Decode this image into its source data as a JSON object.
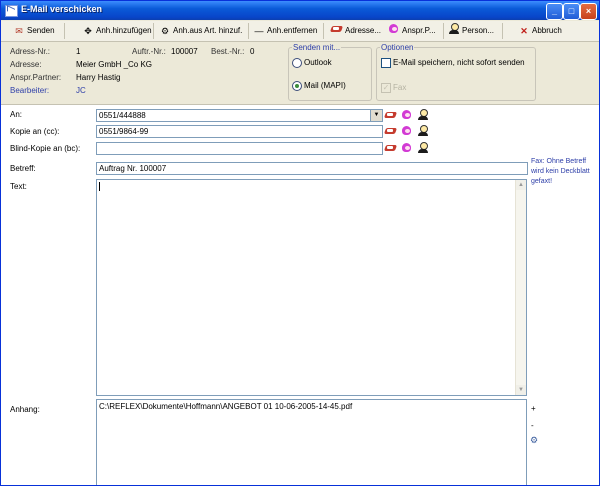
{
  "window": {
    "title": "E-Mail verschicken"
  },
  "toolbar": {
    "send": "Senden",
    "add_attachment": "Anh.hinzufügen",
    "add_from_article": "Anh.aus Art. hinzuf.",
    "remove_attachment": "Anh.entfernen",
    "address": "Adresse...",
    "contact_person": "Anspr.P...",
    "person": "Person...",
    "cancel": "Abbruch"
  },
  "info": {
    "address_no_label": "Adress-Nr.:",
    "address_no_value": "1",
    "order_no_label": "Auftr.-Nr.:",
    "order_no_value": "100007",
    "best_no_label": "Best.-Nr.:",
    "best_no_value": "0",
    "address_label": "Adresse:",
    "address_value": "Meier GmbH _Co KG",
    "contact_label": "Anspr.Partner:",
    "contact_value": "Harry Hastig",
    "editor_label": "Bearbeiter:",
    "editor_value": "JC"
  },
  "send_with": {
    "legend": "Senden mit...",
    "outlook": "Outlook",
    "mapi": "Mail (MAPI)"
  },
  "options": {
    "legend": "Optionen",
    "save_not_send": "E-Mail speichern, nicht sofort senden",
    "fax": "Fax"
  },
  "form": {
    "to_label": "An:",
    "to_value": "0551/444888",
    "cc_label": "Kopie an (cc):",
    "cc_value": "0551/9864-99",
    "bcc_label": "Blind-Kopie an (bc):",
    "bcc_value": "",
    "subject_label": "Betreff:",
    "subject_value": "Auftrag Nr. 100007",
    "text_label": "Text:",
    "text_value": "",
    "attachment_label": "Anhang:",
    "attachment_value": "C:\\REFLEX\\Dokumente\\Hoffmann\\ANGEBOT 01 10-06-2005-14-45.pdf",
    "fax_note": "Fax: Ohne Betreff wird kein Deckblatt gefaxt!",
    "plus": "+",
    "minus": "-"
  }
}
